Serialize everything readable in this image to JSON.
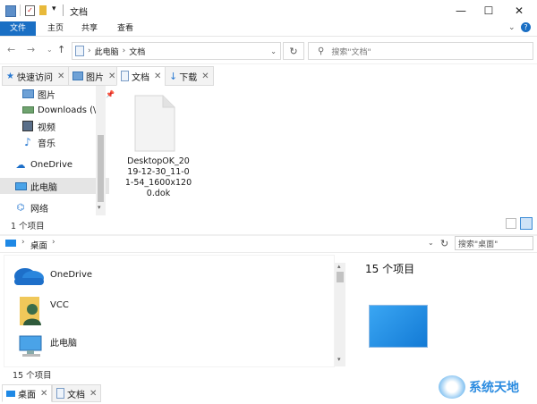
{
  "window": {
    "title": "文档",
    "minimize_glyph": "—",
    "maximize_glyph": "☐",
    "close_glyph": "✕"
  },
  "ribbon": {
    "tabs": [
      "文件",
      "主页",
      "共享",
      "查看"
    ]
  },
  "nav": {
    "breadcrumb": [
      "此电脑",
      "文档"
    ],
    "search_placeholder": "搜索\"文档\""
  },
  "group_tabs": [
    {
      "label": "快速访问",
      "icon": "star-icon"
    },
    {
      "label": "图片",
      "icon": "pictures-icon"
    },
    {
      "label": "文档",
      "icon": "document-icon"
    },
    {
      "label": "下载",
      "icon": "download-icon"
    }
  ],
  "nav_pane": [
    {
      "label": "图片",
      "icon": "pictures-icon"
    },
    {
      "label": "Downloads (\\\\V",
      "icon": "network-drive-icon"
    },
    {
      "label": "视频",
      "icon": "video-icon"
    },
    {
      "label": "音乐",
      "icon": "music-icon"
    },
    {
      "label": "OneDrive",
      "icon": "onedrive-icon"
    },
    {
      "label": "此电脑",
      "icon": "computer-icon"
    },
    {
      "label": "网络",
      "icon": "network-icon"
    }
  ],
  "files": [
    {
      "name_lines": [
        "DesktopOK_20",
        "19-12-30_11-0",
        "1-54_1600x120",
        "0.dok"
      ]
    }
  ],
  "status_top": "1 个项目",
  "pane2": {
    "breadcrumb": "桌面",
    "search_placeholder": "搜索\"桌面\"",
    "items": [
      {
        "label": "OneDrive",
        "icon": "onedrive-icon"
      },
      {
        "label": "VCC",
        "icon": "user-folder-icon"
      },
      {
        "label": "此电脑",
        "icon": "computer-icon"
      }
    ],
    "count_label": "15 个项目",
    "status": "15 个项目"
  },
  "group_tabs_bottom": [
    {
      "label": "桌面",
      "icon": "desktop-icon"
    },
    {
      "label": "文档",
      "icon": "document-icon"
    }
  ],
  "watermark": {
    "text": "系统天地"
  },
  "colors": {
    "accent": "#1a6fc4",
    "selected": "#e5e5e5"
  }
}
